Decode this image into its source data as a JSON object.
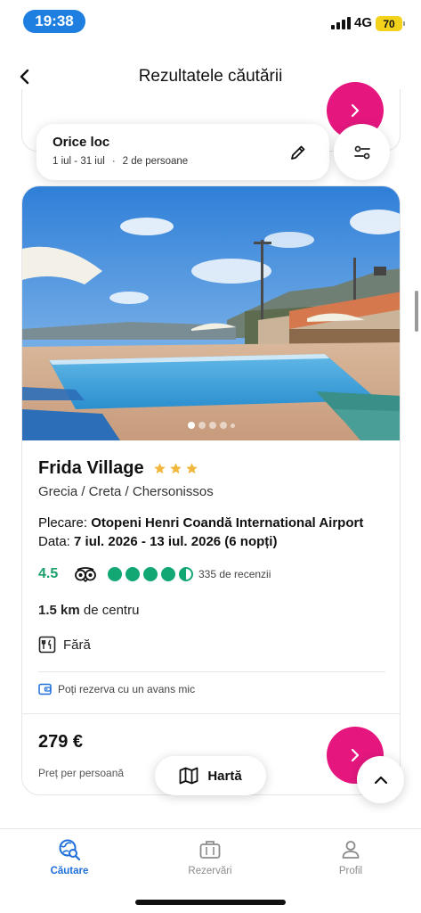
{
  "status_bar": {
    "time": "19:38",
    "network": "4G",
    "battery": "70"
  },
  "header": {
    "title": "Rezultatele căutării"
  },
  "search": {
    "destination": "Orice loc",
    "date_range": "1 iul - 31 iul",
    "separator": "·",
    "guests": "2 de persoane"
  },
  "hotel": {
    "name": "Frida Village",
    "stars": 3,
    "location": "Grecia / Creta / Chersonissos",
    "departure_label": "Plecare:",
    "departure_value": "Otopeni Henri Coandă International Airport",
    "dates_label": "Data:",
    "dates_value": "7 iul. 2026 - 13 iul. 2026 (6 nopți)",
    "rating": "4.5",
    "rating_bubbles": 4.5,
    "reviews": "335 de recenzii",
    "distance_value": "1.5 km",
    "distance_suffix": "de centru",
    "meal": "Fără",
    "deposit_note": "Poți rezerva cu un avans mic",
    "price": "279 €",
    "price_note": "Preț per persoană",
    "photo_count": 5,
    "photo_index": 1
  },
  "map_button": {
    "label": "Hartă"
  },
  "bottom_nav": {
    "items": [
      {
        "label": "Căutare",
        "icon": "search-globe-icon",
        "active": true
      },
      {
        "label": "Rezervări",
        "icon": "briefcase-icon",
        "active": false
      },
      {
        "label": "Profil",
        "icon": "user-icon",
        "active": false
      }
    ]
  },
  "colors": {
    "accent_pink": "#e5177f",
    "rating_green": "#12a773",
    "nav_active_blue": "#1e6fd9",
    "time_pill_blue": "#1f7fe0",
    "star_gold": "#f2b73d"
  }
}
